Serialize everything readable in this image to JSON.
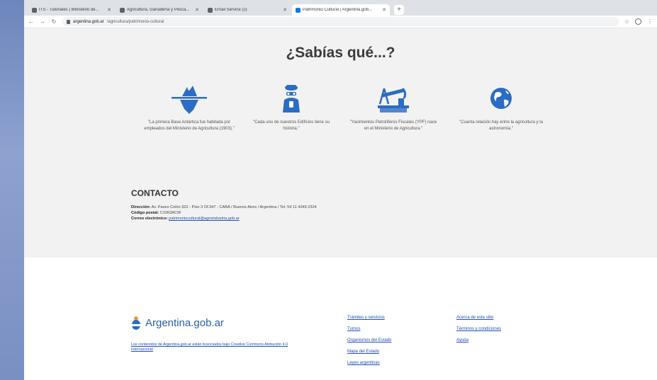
{
  "browser": {
    "tabs": [
      {
        "title": "ITS - Tutoriales | Ministerio de...",
        "active": false
      },
      {
        "title": "Agricultura, Ganadería y Pesca...",
        "active": false
      },
      {
        "title": "Email Service (2)",
        "active": false
      },
      {
        "title": "Patrimonio Cultural | Argentina.gob...",
        "active": true
      }
    ],
    "url_host": "argentina.gob.ar",
    "url_path": "/agricultura/patrimonio-cultural"
  },
  "sabias": {
    "title": "¿Sabías qué...?",
    "facts": [
      {
        "icon": "iceberg-icon",
        "text": "\"La primera Base Antártica fue habitada por empleados del Ministerio de Agricultura (1903).\""
      },
      {
        "icon": "scientist-icon",
        "text": "\"Cada uno de nuestros Edificios tiene su historia.\""
      },
      {
        "icon": "oil-pump-icon",
        "text": "\"Yacimientos Petrolíferos Fiscales (YPF) nace en el Ministerio de Agricultura.\""
      },
      {
        "icon": "globe-icon",
        "text": "\"Cuanta relación hay entre la agricultura y la astronomía.\""
      }
    ]
  },
  "contacto": {
    "title": "CONTACTO",
    "direccion_label": "Dirección:",
    "direccion": "Av. Paseo Colón 922 - Piso 3 Of.347 - CABA / Buenos Aires / Argentina / Tel. 54 11 4349 2324",
    "cp_label": "Código postal:",
    "cp": "C1063ACW",
    "email_label": "Correo electrónico:",
    "email": "patrimoniocultural@agroindustria.gob.ar"
  },
  "footer": {
    "logo_text": "Argentina.gob.ar",
    "license": "Los contenidos de Argentina.gob.ar están licenciados bajo Creative Commons Atribución 4.0 Internacional",
    "col1": [
      "Trámites y servicios",
      "Turnos",
      "Organismos del Estado",
      "Mapa del Estado",
      "Leyes argentinas"
    ],
    "col2": [
      "Acerca de este sitio",
      "Términos y condiciones",
      "Ayuda"
    ]
  },
  "colors": {
    "accent": "#2b6cc4",
    "link": "#1f4db2"
  }
}
